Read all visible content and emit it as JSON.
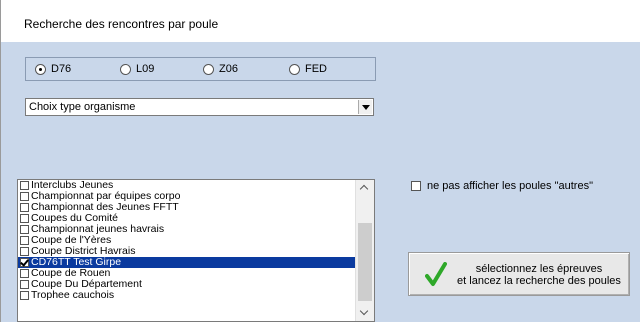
{
  "window": {
    "title": "Recherche des rencontres par poule"
  },
  "radios": [
    {
      "label": "D76",
      "selected": true
    },
    {
      "label": "L09",
      "selected": false
    },
    {
      "label": "Z06",
      "selected": false
    },
    {
      "label": "FED",
      "selected": false
    }
  ],
  "select": {
    "value": "Choix type organisme"
  },
  "list": {
    "items": [
      {
        "label": "Interclubs Jeunes",
        "checked": false,
        "selected": false
      },
      {
        "label": "Championnat par équipes corpo",
        "checked": false,
        "selected": false
      },
      {
        "label": "Championnat des Jeunes FFTT",
        "checked": false,
        "selected": false
      },
      {
        "label": "Coupes du Comité",
        "checked": false,
        "selected": false
      },
      {
        "label": "Championnat jeunes havrais",
        "checked": false,
        "selected": false
      },
      {
        "label": "Coupe de l'Yères",
        "checked": false,
        "selected": false
      },
      {
        "label": "Coupe District Havrais",
        "checked": false,
        "selected": false
      },
      {
        "label": "CD76TT Test Girpe",
        "checked": true,
        "selected": true
      },
      {
        "label": "Coupe de Rouen",
        "checked": false,
        "selected": false
      },
      {
        "label": "Coupe Du Département",
        "checked": false,
        "selected": false
      },
      {
        "label": "Trophee cauchois",
        "checked": false,
        "selected": false
      }
    ]
  },
  "option_checkbox": {
    "label": "ne pas afficher les poules \"autres\"",
    "checked": false
  },
  "action_button": {
    "line1": "sélectionnez les épreuves",
    "line2": "et lancez la recherche des poules",
    "icon": "green-check-icon",
    "icon_color": "#2ea829"
  },
  "colors": {
    "client_bg": "#c9d7ea",
    "selection": "#0a3a9f"
  }
}
